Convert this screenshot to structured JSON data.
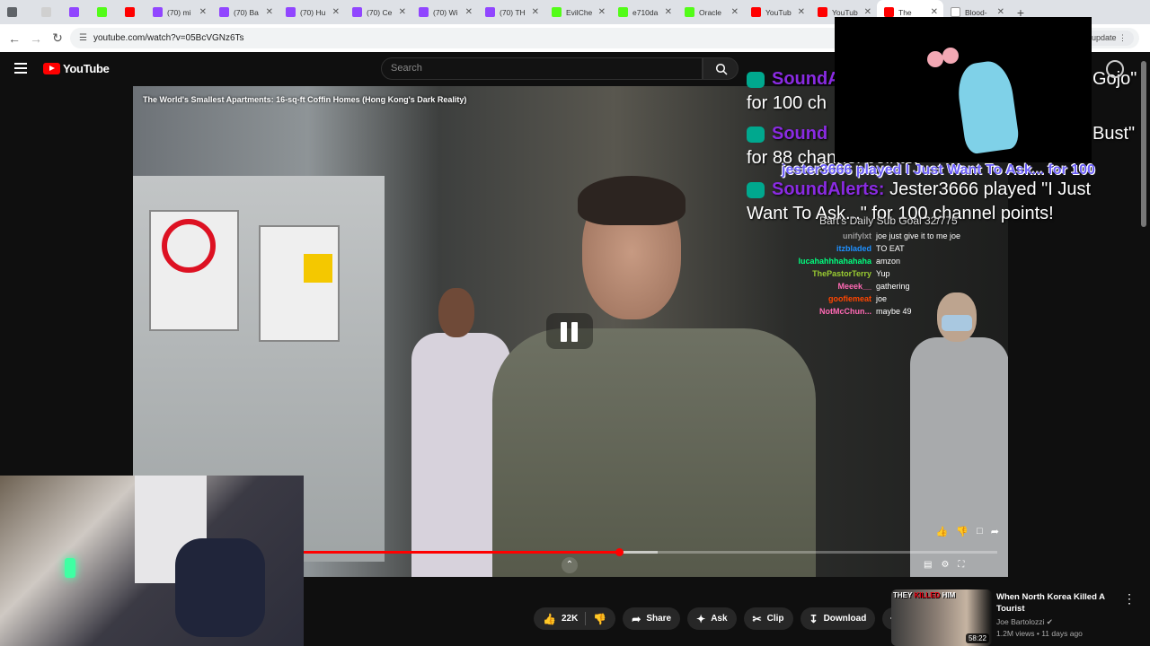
{
  "browser": {
    "tabs": [
      {
        "label": "",
        "color": "#5f6368"
      },
      {
        "label": "",
        "color": "#d0d0d0"
      },
      {
        "label": "",
        "color": "#9146ff"
      },
      {
        "label": "",
        "color": "#53fc18"
      },
      {
        "label": "",
        "color": "#ff0000"
      },
      {
        "label": "(70) mi",
        "color": "#9146ff"
      },
      {
        "label": "(70) Ba",
        "color": "#9146ff"
      },
      {
        "label": "(70) Hu",
        "color": "#9146ff"
      },
      {
        "label": "(70) Ce",
        "color": "#9146ff"
      },
      {
        "label": "(70) Wi",
        "color": "#9146ff"
      },
      {
        "label": "(70) TH",
        "color": "#9146ff"
      },
      {
        "label": "EvilChe",
        "color": "#53fc18"
      },
      {
        "label": "e710da",
        "color": "#53fc18"
      },
      {
        "label": "Oracle",
        "color": "#53fc18"
      },
      {
        "label": "YouTub",
        "color": "#ff0000"
      },
      {
        "label": "YouTub",
        "color": "#ff0000"
      },
      {
        "label": "The",
        "color": "#ff0000",
        "active": true
      },
      {
        "label": "Blood-",
        "color": "#ffffff"
      }
    ],
    "url": "youtube.com/watch?v=05BcVGNz6Ts",
    "update_label": "h to update"
  },
  "yt": {
    "logo": "YouTube",
    "search_placeholder": "Search"
  },
  "video": {
    "title": "The World's Smallest Apartments: 16-sq-ft Coffin Homes (Hong Kong's Dark Reality)",
    "progress_fraction": 0.455,
    "buffer_fraction": 0.51
  },
  "overlay": {
    "alert1_who": "SoundA",
    "alert1_tail": "Gojo\"",
    "alert1_line2": "for 100 ch",
    "alert2_who": "Sound",
    "alert2_tail": "Bust\"",
    "alert2_line2": "for 88 channel points!",
    "alert3_who": "SoundAlerts:",
    "alert3_text": "Jester3666 played \"I Just",
    "alert3_line2": "Want To Ask...\" for 100 channel points!",
    "jester_banner": "jester3666 played I Just Want To Ask... for 100",
    "goal": "Bart's Daily Sub Goal 32/775",
    "chat": [
      {
        "user": "unifylxt",
        "color": "#9a9a9a",
        "msg": "joe just give it to me joe"
      },
      {
        "user": "itzbladed",
        "color": "#1e90ff",
        "msg": "TO EAT"
      },
      {
        "user": "lucahahhhahahaha",
        "color": "#00ff7f",
        "msg": "amzon"
      },
      {
        "user": "ThePastorTerry",
        "color": "#9acd32",
        "msg": "Yup"
      },
      {
        "user": "Meeek__",
        "color": "#ff69b4",
        "msg": "gathering"
      },
      {
        "user": "goofiemeat",
        "color": "#ff4500",
        "msg": "joe"
      },
      {
        "user": "NotMcChun...",
        "color": "#ff69b4",
        "msg": "maybe 49"
      }
    ]
  },
  "actions": {
    "like_count": "22K",
    "share": "Share",
    "ask": "Ask",
    "clip": "Clip",
    "download": "Download",
    "more": "⋯"
  },
  "recommendation": {
    "thumb_text_1": "THEY",
    "thumb_text_2": "KILLED",
    "thumb_text_3": "HIM",
    "duration": "58:22",
    "title": "When North Korea Killed A Tourist",
    "channel": "Joe Bartolozzi",
    "meta": "1.2M views • 11 days ago"
  },
  "icons": [
    "chrome-icon",
    "refresh-icon",
    "back-icon",
    "forward-icon",
    "search-icon",
    "like-icon",
    "dislike-icon",
    "share-icon",
    "ask-icon",
    "clip-icon",
    "download-icon",
    "pause-icon",
    "more-icon"
  ]
}
